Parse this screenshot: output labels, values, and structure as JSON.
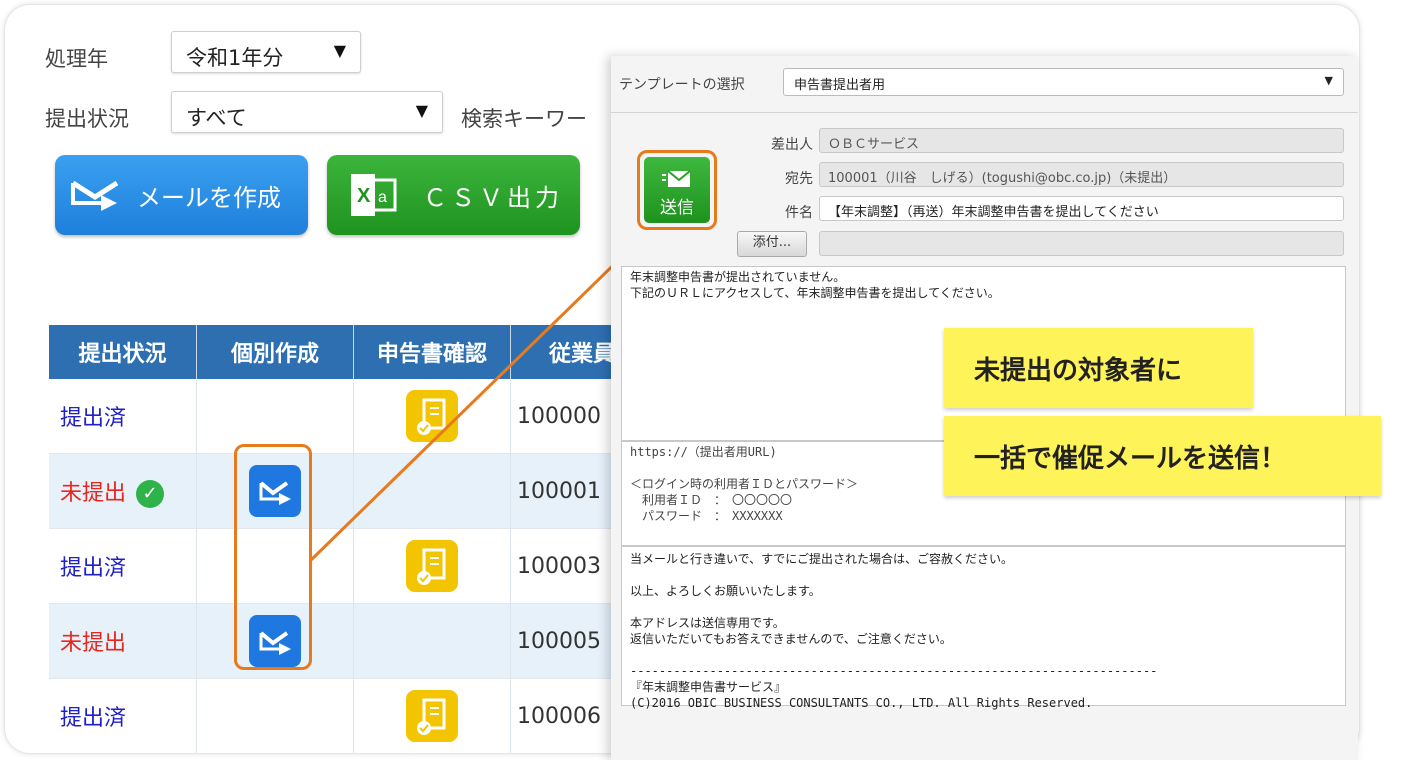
{
  "filters": {
    "year_label": "処理年",
    "year_value": "令和1年分",
    "status_label": "提出状況",
    "status_value": "すべて",
    "keyword_label": "検索キーワー"
  },
  "buttons": {
    "create_mail": "メールを作成",
    "csv_export": "ＣＳＶ出力"
  },
  "table": {
    "headers": [
      "提出状況",
      "個別作成",
      "申告書確認",
      "従業員"
    ],
    "rows": [
      {
        "status": "提出済",
        "status_type": "done",
        "checked": false,
        "has_mail": false,
        "has_doc": true,
        "employee": "100000"
      },
      {
        "status": "未提出",
        "status_type": "not",
        "checked": true,
        "has_mail": true,
        "has_doc": false,
        "employee": "100001"
      },
      {
        "status": "提出済",
        "status_type": "done",
        "checked": false,
        "has_mail": false,
        "has_doc": true,
        "employee": "100003"
      },
      {
        "status": "未提出",
        "status_type": "not",
        "checked": false,
        "has_mail": true,
        "has_doc": false,
        "employee": "100005"
      },
      {
        "status": "提出済",
        "status_type": "done",
        "checked": false,
        "has_mail": false,
        "has_doc": true,
        "employee": "100006"
      }
    ]
  },
  "mail_panel": {
    "template_label": "テンプレートの選択",
    "template_value": "申告書提出者用",
    "send_label": "送信",
    "sender_label": "差出人",
    "sender_value": "ＯＢＣサービス",
    "to_label": "宛先",
    "to_value": "100001（川谷　しげる）(togushi@obc.co.jp)（未提出）",
    "subject_label": "件名",
    "subject_value": "【年末調整】（再送）年末調整申告書を提出してください",
    "attach_label": "添付...",
    "body1": "年末調整申告書が提出されていません。\n下記のＵＲＬにアクセスして、年末調整申告書を提出してください。",
    "body2": "https://（提出者用URL)\n\n＜ログイン時の利用者ＩＤとパスワード＞\n　利用者ＩＤ　：　〇〇〇〇〇\n　パスワード　：　XXXXXXX",
    "body3": "当メールと行き違いで、すでにご提出された場合は、ご容赦ください。\n\n以上、よろしくお願いいたします。\n\n本アドレスは送信専用です。\n返信いただいてもお答えできませんので、ご注意ください。\n\n-------------------------------------------------------------------------\n『年末調整申告書サービス』\n(C)2016 OBIC BUSINESS CONSULTANTS CO., LTD. All Rights Reserved."
  },
  "callout": {
    "line1": "未提出の対象者に",
    "line2": "一括で催促メールを送信！"
  },
  "colors": {
    "accent_orange": "#e87a1e",
    "header_blue": "#2e6fb1",
    "done_text": "#2020c8",
    "not_text": "#e8261e",
    "callout_yellow": "#fff35a"
  }
}
